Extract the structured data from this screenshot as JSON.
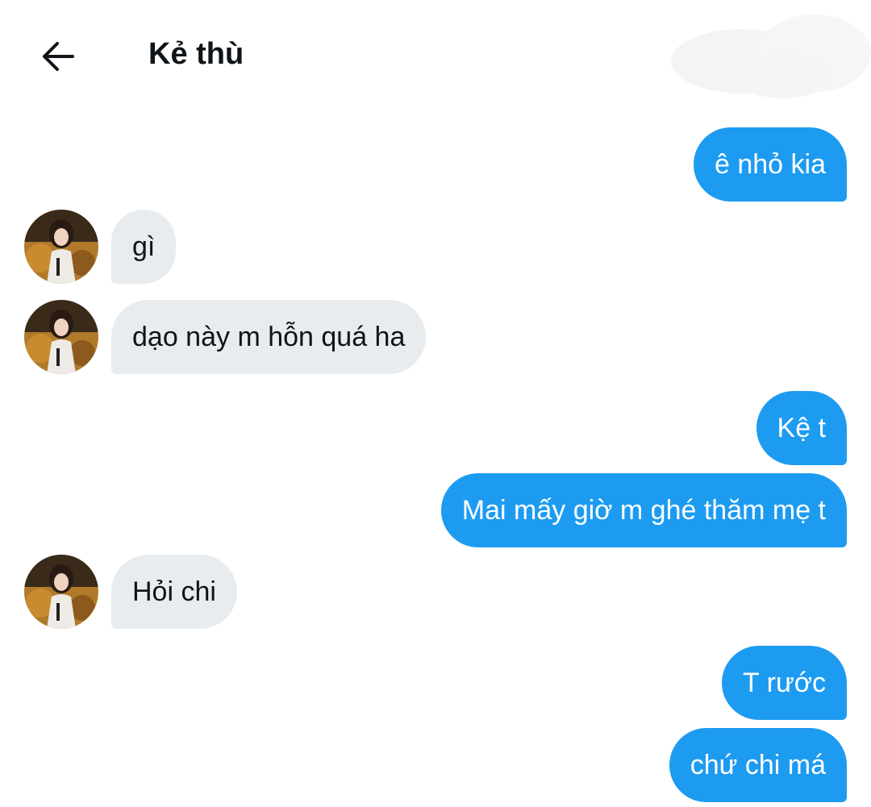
{
  "header": {
    "back_icon": "arrow-left-icon",
    "title": "Kẻ thù"
  },
  "colors": {
    "outgoing_bubble": "#1d9bf0",
    "incoming_bubble": "#e8ecef",
    "text_dark": "#0f1419",
    "background": "#ffffff"
  },
  "messages": [
    {
      "direction": "out",
      "text": "ê nhỏ kia"
    },
    {
      "direction": "in",
      "text": "gì"
    },
    {
      "direction": "in",
      "text": "dạo này m hỗn quá ha"
    },
    {
      "direction": "out",
      "text": "Kệ t"
    },
    {
      "direction": "out",
      "text": "Mai mấy giờ m ghé thăm mẹ t"
    },
    {
      "direction": "in",
      "text": "Hỏi chi"
    },
    {
      "direction": "out",
      "text": "T rước"
    },
    {
      "direction": "out",
      "text": "chứ chi má"
    }
  ]
}
